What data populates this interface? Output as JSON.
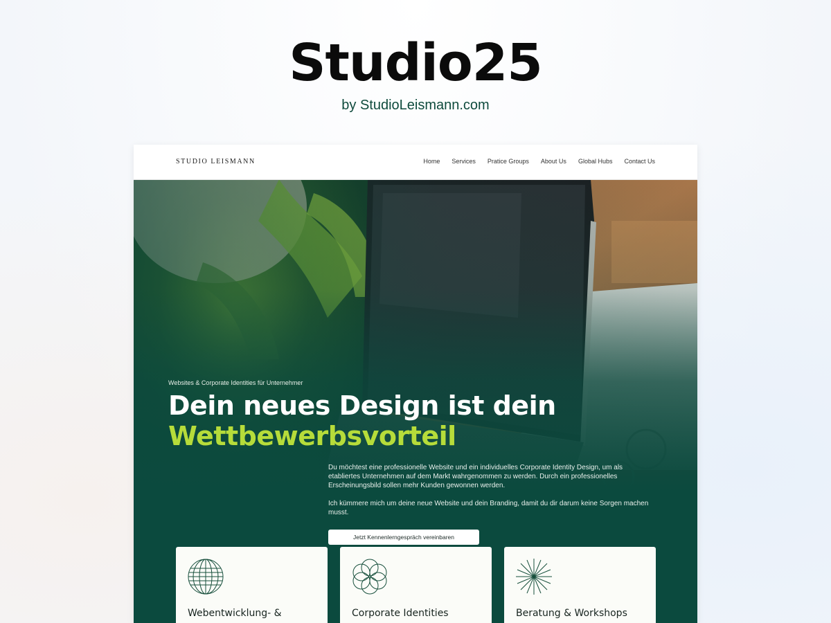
{
  "showcase": {
    "title": "Studio25",
    "subtitle": "by StudioLeismann.com"
  },
  "site": {
    "logo": "STUDIO LEISMANN",
    "nav": [
      "Home",
      "Services",
      "Pratice Groups",
      "About Us",
      "Global Hubs",
      "Contact Us"
    ],
    "hero": {
      "eyebrow": "Websites & Corporate Identities für Unternehmer",
      "headline_line1": "Dein neues Design ist dein",
      "headline_accent": "Wettbewerbsvorteil",
      "paragraph1": "Du möchtest eine professionelle Website und ein individuelles Corporate Identity Design, um als etabliertes Unternehmen auf dem Markt wahrgenommen zu werden. Durch ein professionelles Erscheinungsbild sollen mehr Kunden gewonnen werden.",
      "paragraph2": "Ich kümmere mich um deine neue Website und dein Branding, damit du dir darum keine Sorgen machen musst.",
      "cta": "Jetzt Kennenlerngespräch vereinbaren"
    },
    "cards": [
      {
        "title": "Webentwicklung- &",
        "icon": "globe-icon"
      },
      {
        "title": "Corporate Identities",
        "icon": "flower-icon"
      },
      {
        "title": "Beratung & Workshops",
        "icon": "starburst-icon"
      }
    ],
    "colors": {
      "brand_green": "#0b4a3e",
      "accent_lime": "#b6dc3a",
      "card_bg": "#fbfcf8"
    }
  }
}
